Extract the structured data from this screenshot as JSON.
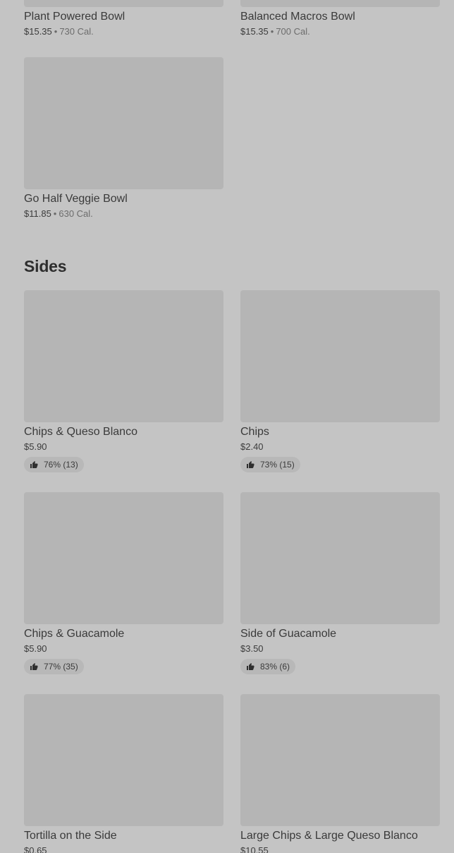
{
  "top_items": [
    {
      "name": "Plant Powered Bowl",
      "price": "$15.35",
      "separator": "•",
      "calories": "730 Cal."
    },
    {
      "name": "Balanced Macros Bowl",
      "price": "$15.35",
      "separator": "•",
      "calories": "700 Cal."
    },
    {
      "name": "Go Half Veggie Bowl",
      "price": "$11.85",
      "separator": "•",
      "calories": "630 Cal."
    }
  ],
  "sides": {
    "title": "Sides",
    "items": [
      {
        "name": "Chips & Queso Blanco",
        "price": "$5.90",
        "rating": "76% (13)"
      },
      {
        "name": "Chips",
        "price": "$2.40",
        "rating": "73% (15)"
      },
      {
        "name": "Chips & Guacamole",
        "price": "$5.90",
        "rating": "77% (35)"
      },
      {
        "name": "Side of Guacamole",
        "price": "$3.50",
        "rating": "83% (6)"
      },
      {
        "name": "Tortilla on the Side",
        "price": "$0.65"
      },
      {
        "name": "Large Chips & Large Queso Blanco",
        "price": "$10.55"
      }
    ]
  },
  "icons": {
    "rating": "thumbs-up-icon"
  },
  "colors": {
    "background": "#c4c4c4",
    "image_placeholder": "#b5b5b5",
    "rating_pill": "#b8b8b8"
  }
}
